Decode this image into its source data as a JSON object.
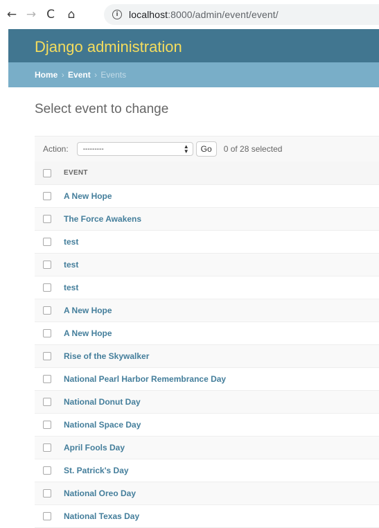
{
  "browser": {
    "back_icon": "←",
    "forward_icon": "→",
    "reload_icon": "C",
    "home_icon": "⌂",
    "info_icon": "i",
    "url_host": "localhost",
    "url_path": ":8000/admin/event/event/"
  },
  "header": {
    "site_name": "Django administration"
  },
  "breadcrumbs": {
    "home": "Home",
    "separator": "›",
    "app": "Event",
    "current": "Events"
  },
  "page": {
    "title": "Select event to change"
  },
  "actions": {
    "label": "Action:",
    "selected_option": "---------",
    "go_label": "Go",
    "selection_count": "0 of 28 selected"
  },
  "table": {
    "column_header": "EVENT",
    "rows": [
      "A New Hope",
      "The Force Awakens",
      "test",
      "test",
      "test",
      "A New Hope",
      "A New Hope",
      "Rise of the Skywalker",
      "National Pearl Harbor Remembrance Day",
      "National Donut Day",
      "National Space Day",
      "April Fools Day",
      "St. Patrick's Day",
      "National Oreo Day",
      "National Texas Day"
    ]
  },
  "colors": {
    "header_bg": "#417690",
    "site_name": "#f5dd5d",
    "breadcrumb_bg": "#79aec8",
    "link": "#447e9b"
  }
}
